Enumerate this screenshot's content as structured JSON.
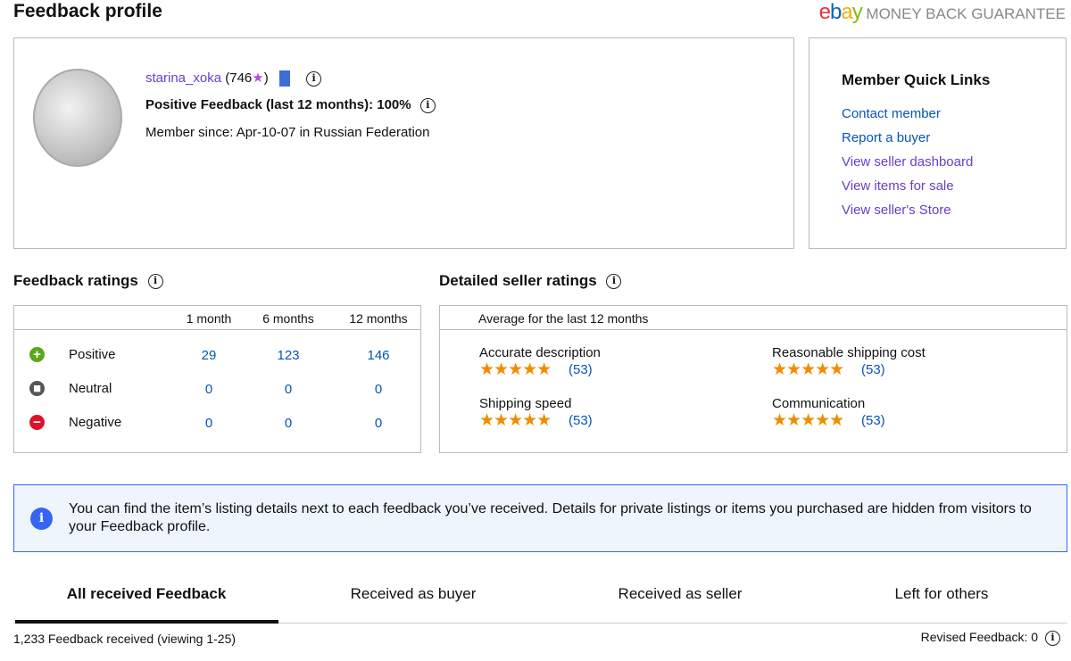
{
  "page_title": "Feedback profile",
  "logo": {
    "brand": "ebay",
    "text": "MONEY BACK GUARANTEE"
  },
  "profile": {
    "username": "starina_xoka",
    "score_open": "(746",
    "score_close": ")",
    "positive_label": "Positive Feedback (last 12 months): 100%",
    "member_since": "Member since: Apr-10-07 in Russian Federation"
  },
  "quick_links": {
    "title": "Member Quick Links",
    "items": [
      "Contact member",
      "Report a buyer",
      "View seller dashboard",
      "View items for sale",
      "View seller's Store"
    ]
  },
  "feedback_ratings": {
    "title": "Feedback ratings",
    "columns": [
      "1 month",
      "6 months",
      "12 months"
    ],
    "rows": [
      {
        "label": "Positive",
        "values": [
          "29",
          "123",
          "146"
        ],
        "color": "#5ba71b",
        "icon": "+"
      },
      {
        "label": "Neutral",
        "values": [
          "0",
          "0",
          "0"
        ],
        "color": "#555",
        "icon": "■"
      },
      {
        "label": "Negative",
        "values": [
          "0",
          "0",
          "0"
        ],
        "color": "#e0102a",
        "icon": "−"
      }
    ]
  },
  "detailed_ratings": {
    "title": "Detailed seller ratings",
    "subtitle": "Average for the last 12 months",
    "items": [
      {
        "label": "Accurate description",
        "count": "(53)",
        "stars": 5
      },
      {
        "label": "Reasonable shipping cost",
        "count": "(53)",
        "stars": 5
      },
      {
        "label": "Shipping speed",
        "count": "(53)",
        "stars": 5
      },
      {
        "label": "Communication",
        "count": "(53)",
        "stars": 5
      }
    ]
  },
  "notice": "You can find the item’s listing details next to each feedback you’ve received. Details for private listings or items you purchased are hidden from visitors to your Feedback profile.",
  "tabs": [
    "All received Feedback",
    "Received as buyer",
    "Received as seller",
    "Left for others"
  ],
  "footer": {
    "count": "1,233 Feedback received (viewing 1-25)",
    "revised": "Revised Feedback: 0"
  }
}
